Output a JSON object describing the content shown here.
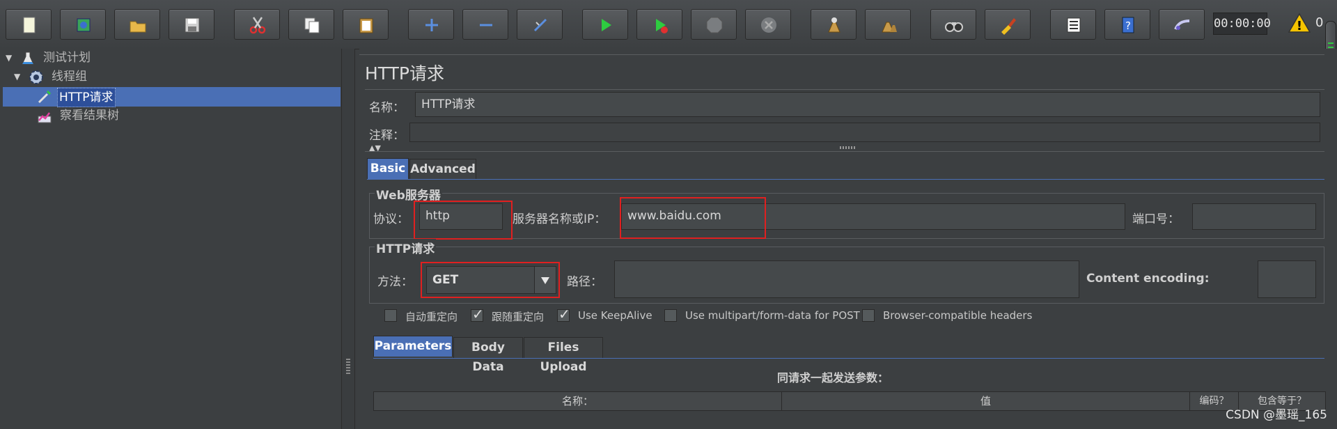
{
  "toolbar": {
    "buttons": [
      {
        "icon": "new-file-icon"
      },
      {
        "icon": "templates-icon"
      },
      {
        "icon": "open-icon"
      },
      {
        "icon": "save-icon"
      },
      {
        "icon": "cut-icon"
      },
      {
        "icon": "copy-icon"
      },
      {
        "icon": "paste-icon"
      },
      {
        "icon": "expand-icon"
      },
      {
        "icon": "collapse-icon"
      },
      {
        "icon": "toggle-icon"
      },
      {
        "icon": "start-icon"
      },
      {
        "icon": "start-no-pause-icon"
      },
      {
        "icon": "stop-icon"
      },
      {
        "icon": "shutdown-icon"
      },
      {
        "icon": "clear-icon"
      },
      {
        "icon": "clear-all-icon"
      },
      {
        "icon": "search-icon"
      },
      {
        "icon": "reset-search-icon"
      },
      {
        "icon": "function-helper-icon"
      },
      {
        "icon": "help-icon"
      },
      {
        "icon": "remote-icon"
      }
    ],
    "timer": "00:00:00",
    "warning_count": "0"
  },
  "tree": {
    "items": [
      {
        "label": "测试计划",
        "icon": "flask-icon"
      },
      {
        "label": "线程组",
        "icon": "gear-icon"
      },
      {
        "label": "HTTP请求",
        "icon": "pipette-icon"
      },
      {
        "label": "察看结果树",
        "icon": "chart-icon"
      }
    ]
  },
  "panel": {
    "title": "HTTP请求",
    "name_label": "名称：",
    "name_value": "HTTP请求",
    "comment_label": "注释：",
    "comment_value": "",
    "tabs": [
      "Basic",
      "Advanced"
    ],
    "web_server": {
      "title": "Web服务器",
      "protocol_label": "协议：",
      "protocol_value": "http",
      "server_label": "服务器名称或IP：",
      "server_value": "www.baidu.com",
      "port_label": "端口号：",
      "port_value": ""
    },
    "http_request": {
      "title": "HTTP请求",
      "method_label": "方法：",
      "method_value": "GET",
      "path_label": "路径：",
      "path_value": "",
      "encoding_label": "Content encoding:",
      "encoding_value": ""
    },
    "checkboxes": [
      {
        "label": "自动重定向",
        "checked": false
      },
      {
        "label": "跟随重定向",
        "checked": true
      },
      {
        "label": "Use KeepAlive",
        "checked": true
      },
      {
        "label": "Use multipart/form-data for POST",
        "checked": false
      },
      {
        "label": "Browser-compatible headers",
        "checked": false
      }
    ],
    "sub_tabs": [
      "Parameters",
      "Body Data",
      "Files Upload"
    ],
    "params_caption": "同请求一起发送参数：",
    "table_columns": [
      "名称：",
      "值",
      "编码？",
      "包含等于？"
    ]
  },
  "colors": {
    "accent": "#4a6fb5",
    "highlight_box": "#e02020",
    "play": "#2ecc40"
  },
  "watermark": "CSDN @墨瑶_165"
}
